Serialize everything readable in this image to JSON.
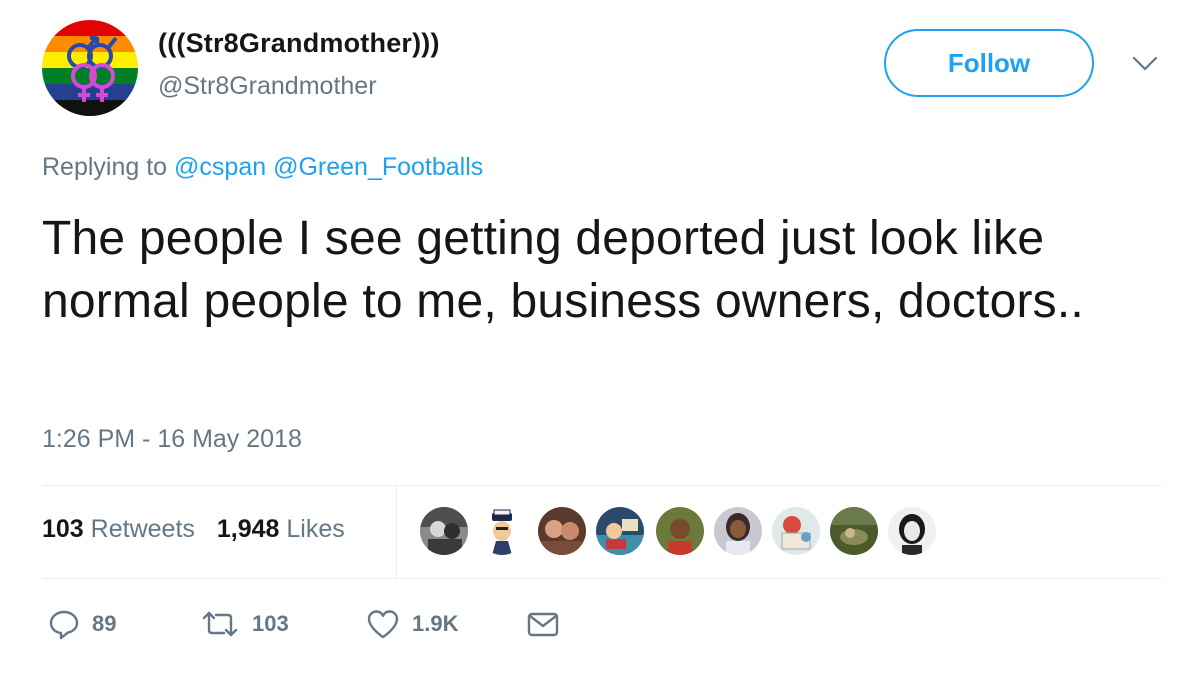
{
  "user": {
    "display_name": "(((Str8Grandmother)))",
    "handle": "@Str8Grandmother",
    "avatar_icon": "rainbow-gender-symbols-avatar"
  },
  "follow_label": "Follow",
  "reply_context": {
    "prefix": "Replying to",
    "mentions": [
      "@cspan",
      "@Green_Footballs"
    ]
  },
  "tweet": {
    "text": "The people I see getting deported just look like normal people to me, business owners, doctors..",
    "timestamp": "1:26 PM - 16 May 2018"
  },
  "stats": {
    "retweets_count": "103",
    "retweets_label": "Retweets",
    "likes_count": "1,948",
    "likes_label": "Likes"
  },
  "actions": {
    "reply_count": "89",
    "retweet_count": "103",
    "like_count": "1.9K"
  },
  "colors": {
    "accent": "#1da1f2",
    "secondary_text": "#657786",
    "primary_text": "#14171a"
  }
}
